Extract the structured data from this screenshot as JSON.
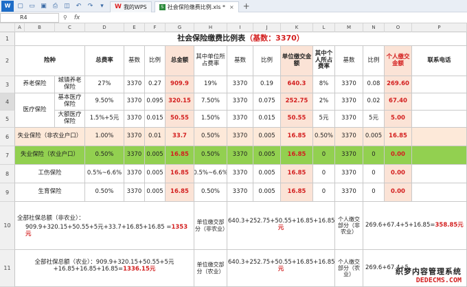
{
  "tabs": [
    {
      "label": "我的WPS",
      "active": false
    },
    {
      "label": "社会保险缴费比例.xls *",
      "active": true
    }
  ],
  "formula_bar": {
    "cell_ref": "R4",
    "fx": "fx"
  },
  "columns": [
    "A",
    "B",
    "C",
    "D",
    "E",
    "F",
    "G",
    "H",
    "I",
    "J",
    "K",
    "L",
    "M",
    "N",
    "O",
    "P"
  ],
  "rows": [
    "1",
    "2",
    "3",
    "4",
    "5",
    "6",
    "7",
    "8",
    "9",
    "10",
    "11"
  ],
  "title": {
    "main": "社会保险缴费比例表",
    "base": "（基数：3370）"
  },
  "header": {
    "type": "险种",
    "total_rate": "总费率",
    "base": "基数",
    "ratio": "比例",
    "total_amount": "总金额",
    "unit_rate": "其中单位所占费率",
    "base2": "基数",
    "ratio2": "比例",
    "unit_amount": "单位缴交金额",
    "personal_rate": "其中个人所占费率",
    "base3": "基数",
    "ratio3": "比例",
    "personal_amount": "个人缴交金额",
    "phone": "联系电话"
  },
  "body": [
    {
      "group": "养老保险",
      "sub": "城镇养老保险",
      "total_rate": "27%",
      "base": "3370",
      "ratio": "0.27",
      "total": "909.9",
      "unit_rate": "19%",
      "base2": "3370",
      "ratio2": "0.19",
      "unit_amt": "640.3",
      "p_rate": "8%",
      "base3": "3370",
      "ratio3": "0.08",
      "p_amt": "269.60"
    },
    {
      "group": "医疗保险",
      "sub": "基本医疗保险",
      "total_rate": "9.50%",
      "base": "3370",
      "ratio": "0.095",
      "total": "320.15",
      "unit_rate": "7.50%",
      "base2": "3370",
      "ratio2": "0.075",
      "unit_amt": "252.75",
      "p_rate": "2%",
      "base3": "3370",
      "ratio3": "0.02",
      "p_amt": "67.40"
    },
    {
      "group": "",
      "sub": "大额医疗保险",
      "total_rate": "1.5%+5元",
      "base": "3370",
      "ratio": "0.015",
      "total": "50.55",
      "unit_rate": "1.50%",
      "base2": "3370",
      "ratio2": "0.015",
      "unit_amt": "50.55",
      "p_rate": "5元",
      "base3": "3370",
      "ratio3": "5元",
      "p_amt": "5.00"
    },
    {
      "group": "失业保险（非农业户口）",
      "total_rate": "1.00%",
      "base": "3370",
      "ratio": "0.01",
      "total": "33.7",
      "unit_rate": "0.50%",
      "base2": "3370",
      "ratio2": "0.005",
      "unit_amt": "16.85",
      "p_rate": "0.50%",
      "base3": "3370",
      "ratio3": "0.005",
      "p_amt": "16.85"
    },
    {
      "group": "失业保险（农业户口）",
      "total_rate": "0.50%",
      "base": "3370",
      "ratio": "0.005",
      "total": "16.85",
      "unit_rate": "0.50%",
      "base2": "3370",
      "ratio2": "0.005",
      "unit_amt": "16.85",
      "p_rate": "0",
      "base3": "3370",
      "ratio3": "0",
      "p_amt": "0.00"
    },
    {
      "group": "工伤保险",
      "total_rate": "0.5%~6.6%",
      "base": "3370",
      "ratio": "0.005",
      "total": "16.85",
      "unit_rate": "0.5%~6.6%",
      "base2": "3370",
      "ratio2": "0.005",
      "unit_amt": "16.85",
      "p_rate": "0",
      "base3": "3370",
      "ratio3": "0",
      "p_amt": "0.00"
    },
    {
      "group": "生育保险",
      "total_rate": "0.50%",
      "base": "3370",
      "ratio": "0.005",
      "total": "16.85",
      "unit_rate": "0.50%",
      "base2": "3370",
      "ratio2": "0.005",
      "unit_amt": "16.85",
      "p_rate": "0",
      "base3": "3370",
      "ratio3": "0",
      "p_amt": "0.00"
    }
  ],
  "summary": {
    "r10_total_label": "全部社保总额（非农业）：",
    "r10_total_formula": "909.9+320.15+50.55+5元+33.7+16.85+16.85 =",
    "r10_total_value": "1353元",
    "r10_unit_label": "单位缴交部分（非农业）",
    "r10_unit_formula": "640.3+252.75+50.55+16.85+16.85+16.85=",
    "r10_unit_value": "994.15元",
    "r10_personal_label": "个人缴交部分（非农业）",
    "r10_personal_formula": "269.6+67.4+5+16.85=",
    "r10_personal_value": "358.85元",
    "r11_total_label": "全部社保总额（农业）：",
    "r11_total_formula": "909.9+320.15+50.55+5元+16.85+16.85+16.85=",
    "r11_total_value": "1336.15元",
    "r11_unit_label": "单位缴交部分（农业）",
    "r11_unit_formula": "640.3+252.75+50.55+16.85+16.85+16.85=",
    "r11_unit_value": "994.15元",
    "r11_personal_label": "个人缴交部分（农业）",
    "r11_personal_formula": "269.6+67.4+5"
  },
  "watermark": {
    "cn": "织梦内容管理系统",
    "en": "DEDECMS.COM"
  }
}
